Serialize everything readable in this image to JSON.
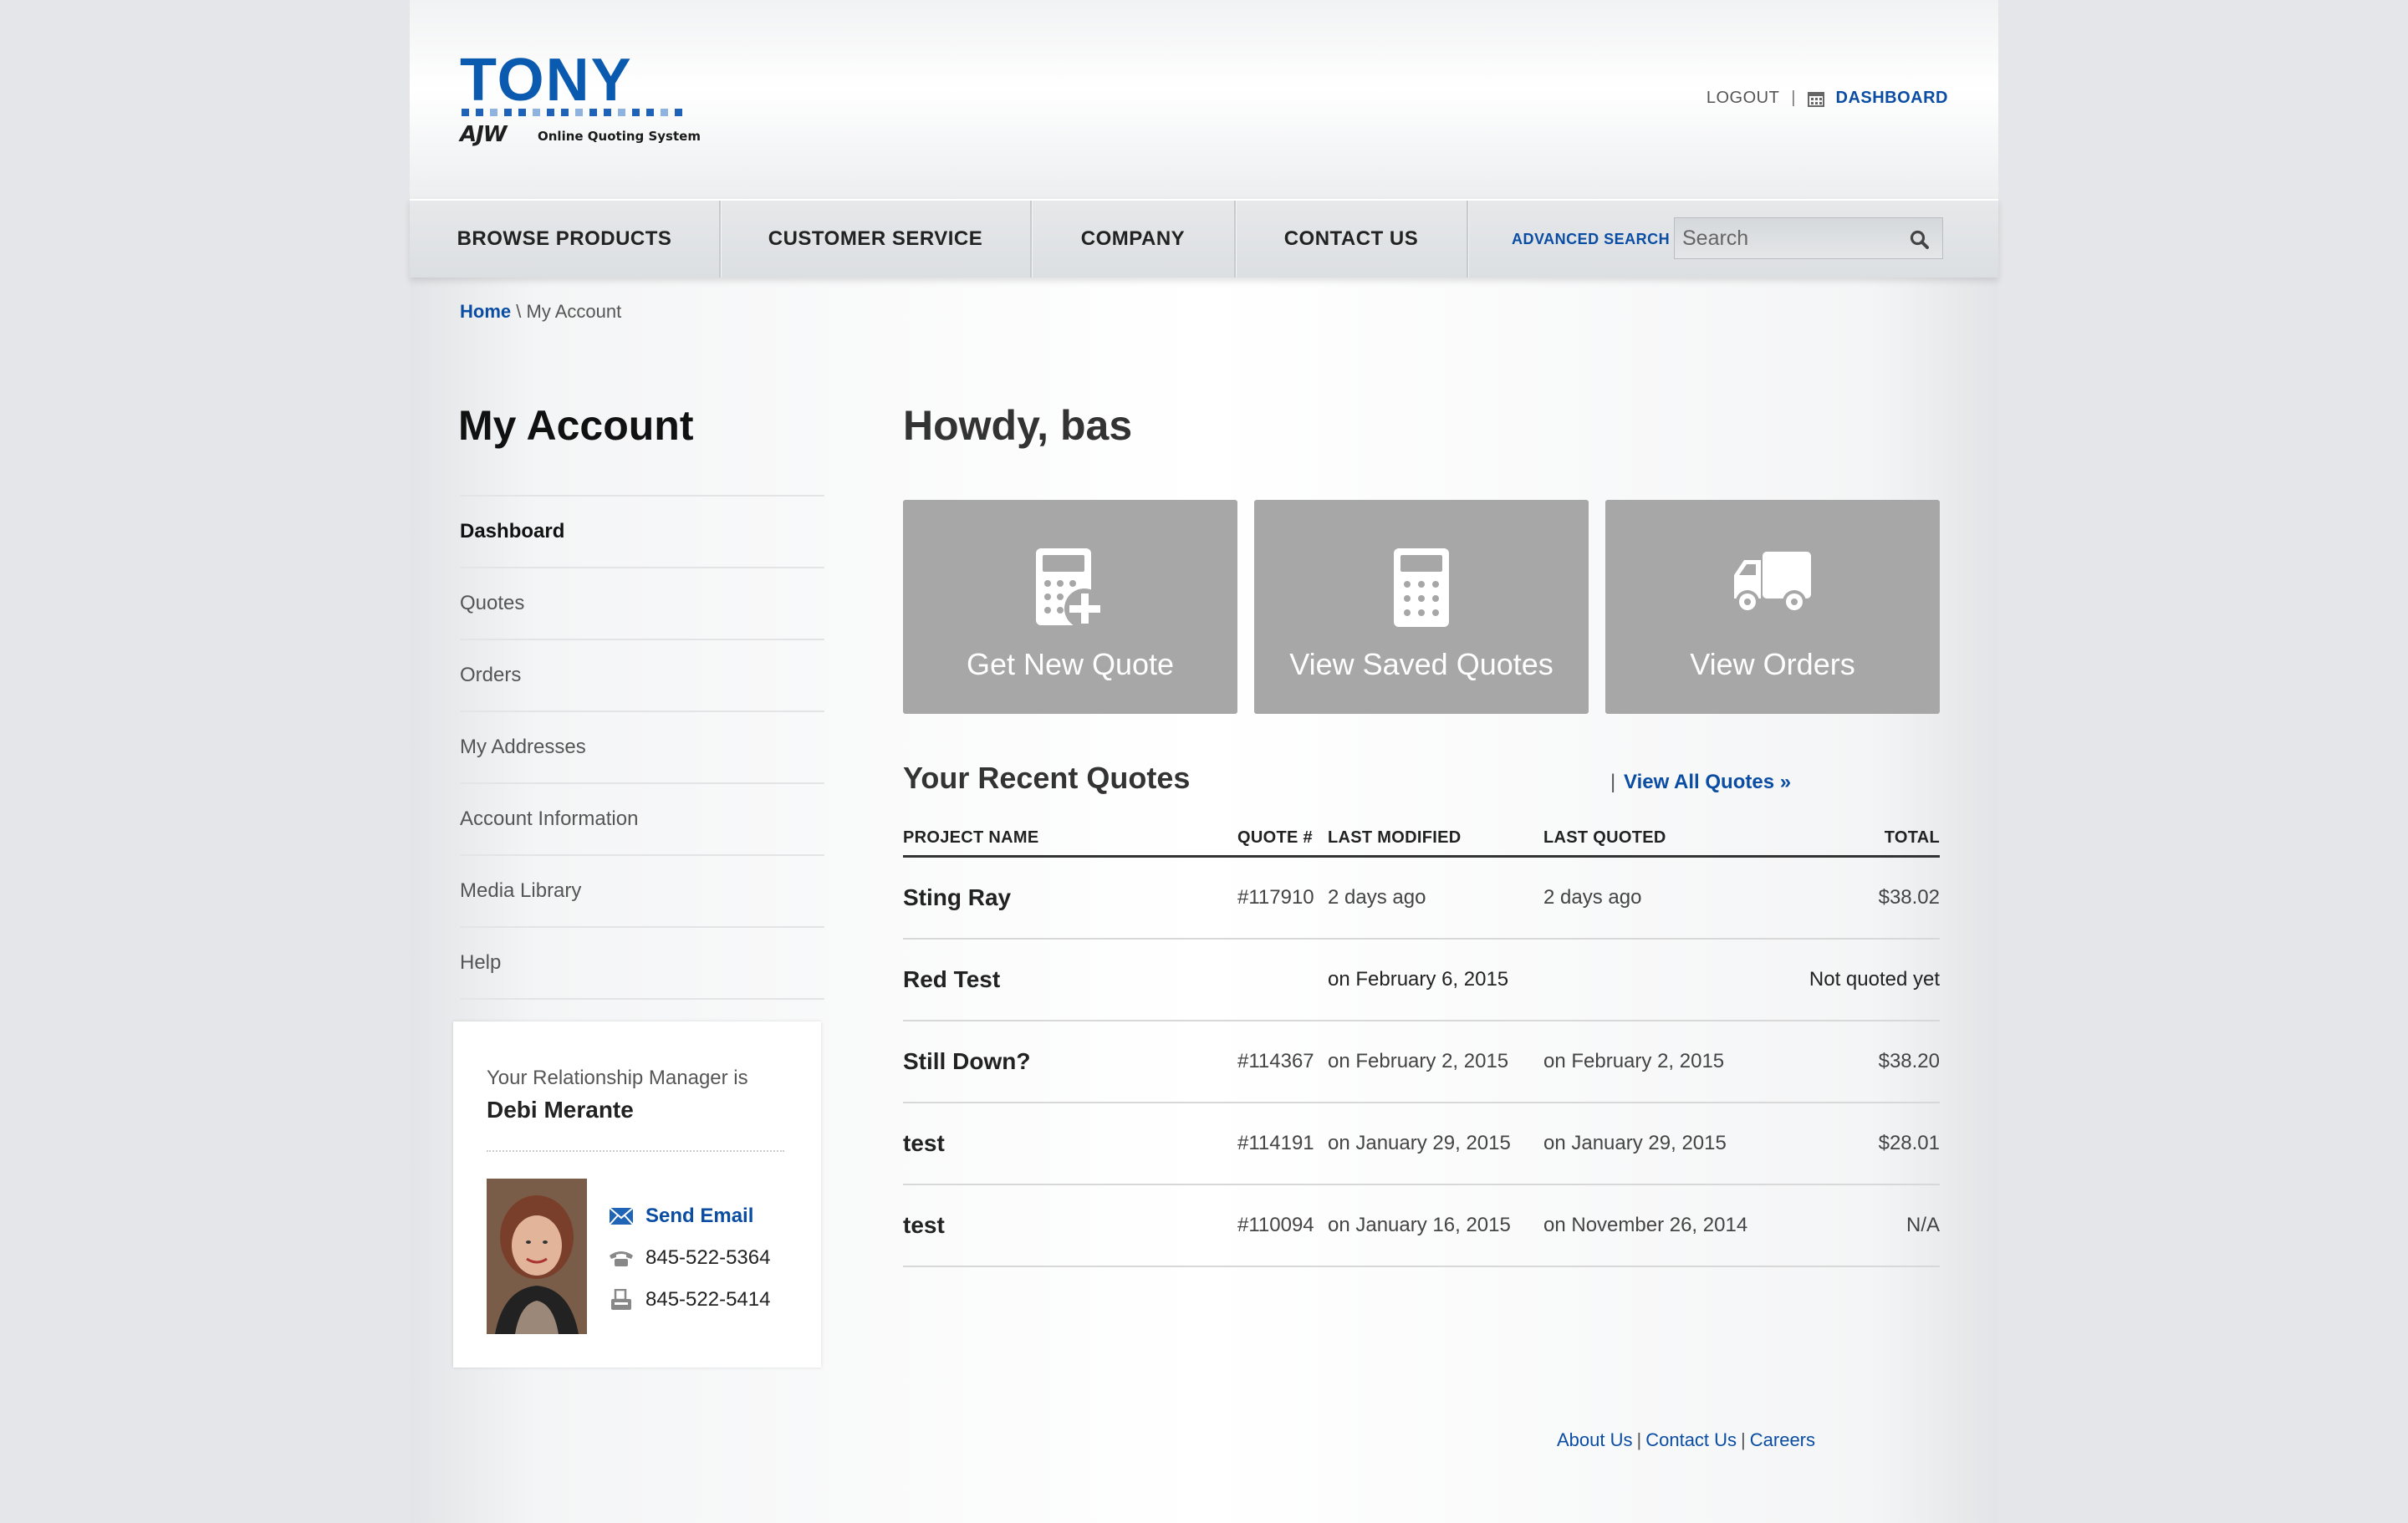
{
  "header": {
    "logo": {
      "word": "TONY",
      "sub_brand": "AJW",
      "tagline": "Online Quoting System"
    },
    "logout_label": "LOGOUT",
    "dashboard_label": "DASHBOARD"
  },
  "nav": {
    "items": [
      "BROWSE PRODUCTS",
      "CUSTOMER SERVICE",
      "COMPANY",
      "CONTACT US"
    ],
    "advanced_search_label": "ADVANCED SEARCH",
    "search_placeholder": "Search"
  },
  "breadcrumb": {
    "home": "Home",
    "separator": "\\",
    "current": "My Account"
  },
  "sidebar": {
    "title": "My Account",
    "items": [
      {
        "label": "Dashboard",
        "active": true
      },
      {
        "label": "Quotes"
      },
      {
        "label": "Orders"
      },
      {
        "label": "My Addresses"
      },
      {
        "label": "Account Information"
      },
      {
        "label": "Media Library"
      },
      {
        "label": "Help"
      }
    ],
    "relationship_manager": {
      "label": "Your Relationship Manager is",
      "name": "Debi Merante",
      "email_label": "Send Email",
      "phone": "845-522-5364",
      "fax": "845-522-5414"
    }
  },
  "main": {
    "greeting": "Howdy, bas",
    "tiles": [
      {
        "label": "Get New Quote",
        "icon": "calculator-plus-icon"
      },
      {
        "label": "View Saved Quotes",
        "icon": "calculator-icon"
      },
      {
        "label": "View Orders",
        "icon": "truck-icon"
      }
    ],
    "recent_quotes": {
      "title": "Your Recent Quotes",
      "separator": "|",
      "view_all_label": "View All Quotes »",
      "columns": [
        "PROJECT NAME",
        "QUOTE #",
        "LAST MODIFIED",
        "LAST QUOTED",
        "TOTAL"
      ],
      "rows": [
        {
          "name": "Sting Ray",
          "quote": "#117910",
          "modified": "2 days ago",
          "quoted": "2 days ago",
          "total": "$38.02"
        },
        {
          "name": "Red Test",
          "quote": "",
          "modified": "on February 6, 2015",
          "quoted": "",
          "total": "Not quoted yet"
        },
        {
          "name": "Still Down?",
          "quote": "#114367",
          "modified": "on February 2, 2015",
          "quoted": "on February 2, 2015",
          "total": "$38.20"
        },
        {
          "name": "test",
          "quote": "#114191",
          "modified": "on January 29, 2015",
          "quoted": "on January 29, 2015",
          "total": "$28.01"
        },
        {
          "name": "test",
          "quote": "#110094",
          "modified": "on January 16, 2015",
          "quoted": "on November 26, 2014",
          "total": "N/A"
        }
      ]
    }
  },
  "footer": {
    "links": [
      "About Us",
      "Contact Us",
      "Careers"
    ],
    "separator": "|"
  },
  "colors": {
    "link_blue": "#0a4da3",
    "tile_gray": "#a7a7a7",
    "brand_blue": "#0a5bb0"
  }
}
